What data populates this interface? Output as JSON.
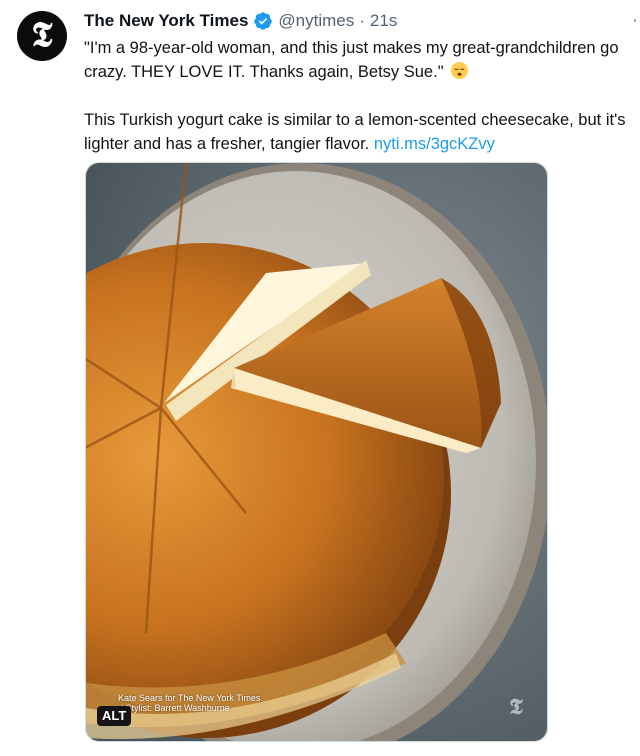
{
  "account": {
    "name": "The New York Times",
    "handle": "@nytimes",
    "separator": "·",
    "time": "21s",
    "avatar_glyph": "𝕿",
    "verified_icon": "verified-badge-icon",
    "verified_color": "#1d9bf0"
  },
  "tweet": {
    "quote_line1": "\"I'm a 98-year-old woman, and this just makes my great-grandchildren go",
    "quote_line2": "crazy. THEY LOVE IT. Thanks again, Betsy Sue.\"",
    "quote_emoji": "relieved-face-emoji",
    "body_line1": "This Turkish yogurt cake is similar to a lemon-scented cheesecake, but it's",
    "body_line2": "lighter and has a fresher, tangier flavor.",
    "link_text": "nyti.ms/3gcKZvy",
    "link_color": "#1d9bf0"
  },
  "media": {
    "description_icon": "cake-photo",
    "credit_line1": "Kate Sears for The New York Times",
    "credit_line2": "d Stylist: Barrett Washburne",
    "alt_label": "ALT",
    "watermark_glyph": "𝕿"
  },
  "more_glyph": "·"
}
